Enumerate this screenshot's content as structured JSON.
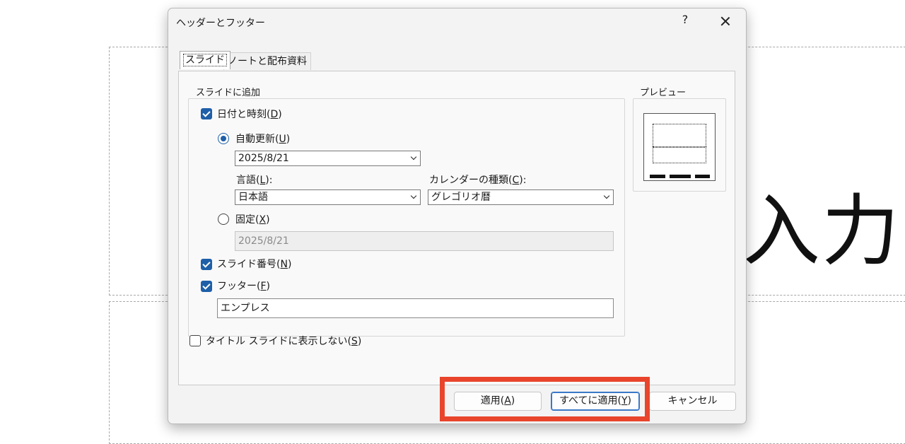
{
  "slide": {
    "title_text": "入力"
  },
  "dialog": {
    "title": "ヘッダーとフッター",
    "help_label": "?",
    "tabs": [
      {
        "label": "スライド",
        "active": true
      },
      {
        "label": "ノートと配布資料",
        "active": false
      }
    ],
    "group_label": "スライドに追加",
    "date_time": {
      "label": "日付と時刻(",
      "hotkey": "D",
      "suffix": ")",
      "checked": true
    },
    "auto_update": {
      "label": "自動更新(",
      "hotkey": "U",
      "suffix": ")",
      "selected": true,
      "value": "2025/8/21"
    },
    "language": {
      "label": "言語(",
      "hotkey": "L",
      "suffix": "):",
      "value": "日本語"
    },
    "calendar": {
      "label": "カレンダーの種類(",
      "hotkey": "C",
      "suffix": "):",
      "value": "グレゴリオ暦"
    },
    "fixed": {
      "label": "固定(",
      "hotkey": "X",
      "suffix": ")",
      "selected": false,
      "value": "2025/8/21"
    },
    "slide_number": {
      "label": "スライド番号(",
      "hotkey": "N",
      "suffix": ")",
      "checked": true
    },
    "footer": {
      "label": "フッター(",
      "hotkey": "F",
      "suffix": ")",
      "checked": true,
      "value": "エンプレス"
    },
    "hide_title": {
      "label": "タイトル スライドに表示しない(",
      "hotkey": "S",
      "suffix": ")",
      "checked": false
    },
    "preview_label": "プレビュー",
    "buttons": {
      "apply": {
        "label": "適用(",
        "hotkey": "A",
        "suffix": ")"
      },
      "apply_all": {
        "label": "すべてに適用(",
        "hotkey": "Y",
        "suffix": ")"
      },
      "cancel": {
        "label": "キャンセル"
      }
    },
    "highlight_color": "#e8452c",
    "accent_color": "#1e5fa8"
  }
}
